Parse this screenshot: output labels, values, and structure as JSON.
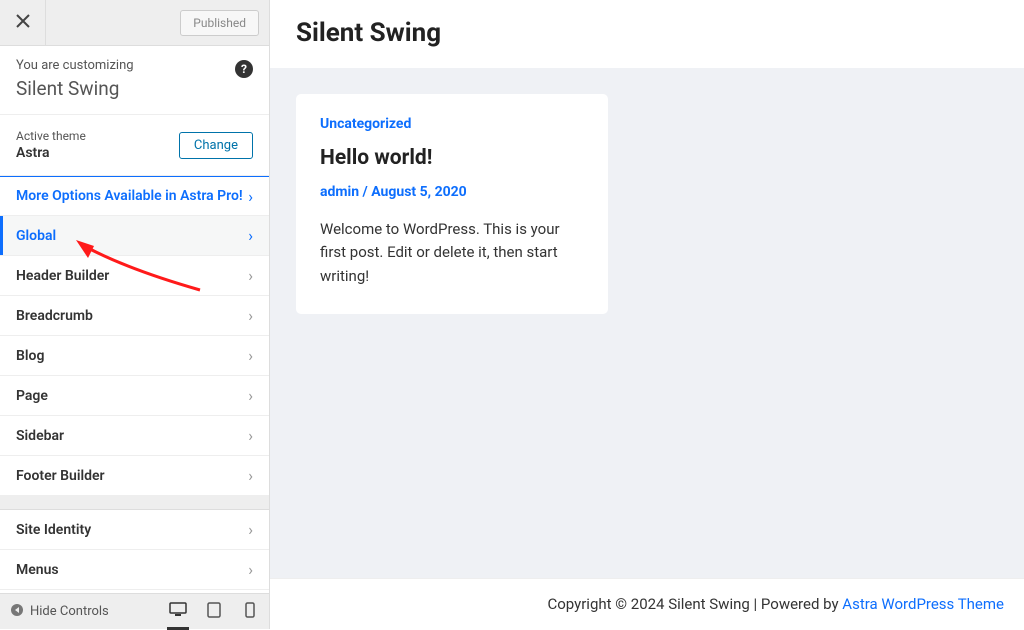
{
  "topbar": {
    "publish_label": "Published"
  },
  "context": {
    "label": "You are customizing",
    "site_name": "Silent Swing"
  },
  "theme": {
    "label": "Active theme",
    "name": "Astra",
    "change_label": "Change"
  },
  "menu": {
    "promo": "More Options Available in Astra Pro!",
    "items": [
      "Global",
      "Header Builder",
      "Breadcrumb",
      "Blog",
      "Page",
      "Sidebar",
      "Footer Builder"
    ],
    "extra": [
      "Site Identity",
      "Menus"
    ]
  },
  "devicebar": {
    "hide_label": "Hide Controls"
  },
  "preview": {
    "site_title": "Silent Swing",
    "post": {
      "category": "Uncategorized",
      "title": "Hello world!",
      "meta": "admin / August 5, 2020",
      "excerpt": "Welcome to WordPress. This is your first post. Edit or delete it, then start writing!"
    },
    "footer_prefix": "Copyright © 2024 Silent Swing | Powered by ",
    "footer_link": "Astra WordPress Theme"
  }
}
